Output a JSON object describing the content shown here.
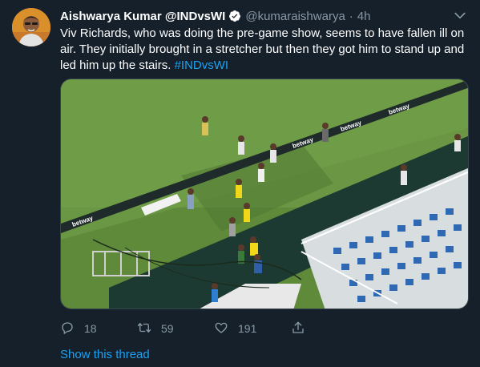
{
  "tweet": {
    "author_name": "Aishwarya Kumar @INDvsWI",
    "handle": "@kumaraishwarya",
    "separator": "·",
    "time": "4h",
    "text": "Viv Richards, who was doing the pre-game show, seems to have fallen ill on air. They initially brought in a stretcher but then they got him to stand up and led him up the stairs.",
    "hashtag": "#INDvsWI"
  },
  "media": {
    "hoarding_text": "betway"
  },
  "actions": {
    "reply_count": "18",
    "retweet_count": "59",
    "like_count": "191"
  },
  "thread_link": "Show this thread",
  "icons": {
    "verified": "verified-badge-icon",
    "more": "chevron-down-icon",
    "reply": "reply-icon",
    "retweet": "retweet-icon",
    "like": "heart-icon",
    "share": "share-icon"
  },
  "colors": {
    "background": "#15202b",
    "text": "#ffffff",
    "secondary": "#8899a6",
    "accent": "#1da1f2"
  }
}
